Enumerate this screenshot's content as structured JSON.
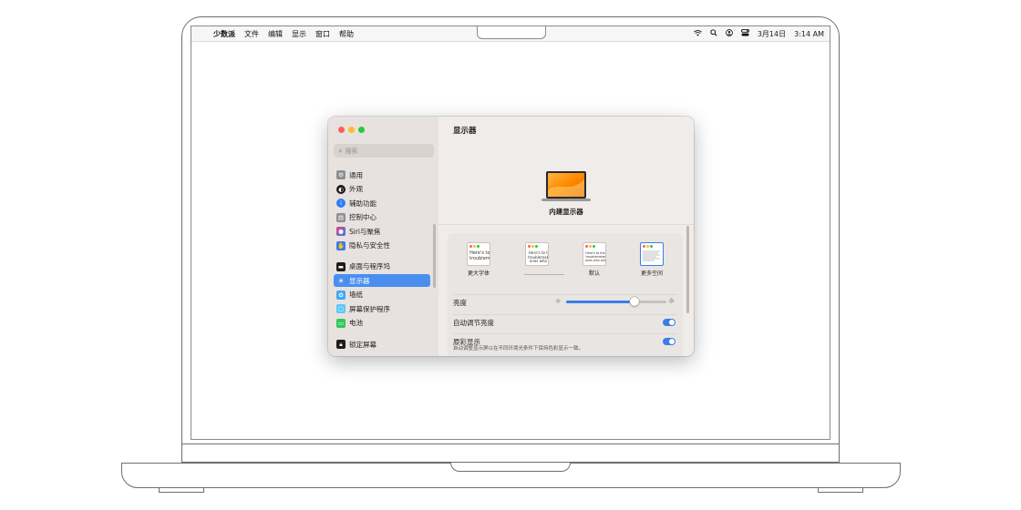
{
  "menubar": {
    "apple": "",
    "app": "少数派",
    "items": [
      "文件",
      "编辑",
      "显示",
      "窗口",
      "帮助"
    ],
    "status_icons": [
      "wifi-icon",
      "search-icon",
      "user-icon",
      "control-center-icon"
    ],
    "date": "3月14日",
    "time": "3:14 AM"
  },
  "window": {
    "traffic_lights": {
      "close": "#ff5f57",
      "minimize": "#febc2e",
      "zoom": "#28c840"
    },
    "search_placeholder": "搜索",
    "sidebar": [
      {
        "label": "通用",
        "icon": "gear-icon",
        "color": "#8e8e93"
      },
      {
        "label": "外观",
        "icon": "appearance-icon",
        "color": "#1c1c1e"
      },
      {
        "label": "辅助功能",
        "icon": "accessibility-icon",
        "color": "#2f7cf6"
      },
      {
        "label": "控制中心",
        "icon": "control-center-icon",
        "color": "#8e8e93"
      },
      {
        "label": "Siri与聚焦",
        "icon": "siri-icon",
        "color": "#7d4ad9"
      },
      {
        "label": "隐私与安全性",
        "icon": "hand-icon",
        "color": "#3a7de8"
      },
      {
        "label": "桌面与程序坞",
        "icon": "dock-icon",
        "color": "#1c1c1e"
      },
      {
        "label": "显示器",
        "icon": "sun-icon",
        "color": "#3a7de8",
        "active": true
      },
      {
        "label": "墙纸",
        "icon": "flower-icon",
        "color": "#3fa9f5"
      },
      {
        "label": "屏幕保护程序",
        "icon": "screensaver-icon",
        "color": "#5ac8fa"
      },
      {
        "label": "电池",
        "icon": "battery-icon",
        "color": "#34c759"
      },
      {
        "label": "锁定屏幕",
        "icon": "lock-icon",
        "color": "#1c1c1e"
      }
    ],
    "content": {
      "title": "显示器",
      "display_name": "内建显示器",
      "resolutions": [
        {
          "label": "更大字体",
          "sample": "Here's to\ntroublem"
        },
        {
          "label": "",
          "sample": "Here's to t\ntroublemak\nones who"
        },
        {
          "label": "默认",
          "sample": "Here's to the c\ntroublemakers\nones who see t"
        },
        {
          "label": "更多空间",
          "sample": "",
          "selected": true
        }
      ],
      "brightness_label": "亮度",
      "brightness_level": 0.68,
      "auto_brightness_label": "自动调节亮度",
      "auto_brightness_on": true,
      "true_tone_label": "原彩显示",
      "true_tone_desc": "自动调整显示屏以在不同环境光条件下保持色彩显示一致。",
      "true_tone_on": true
    }
  }
}
